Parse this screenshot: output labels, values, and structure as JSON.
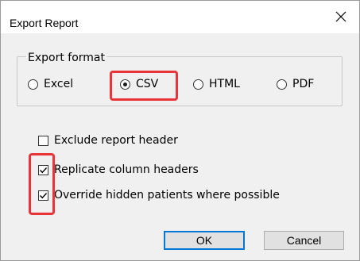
{
  "dialog": {
    "title": "Export Report",
    "close_icon": "close-icon"
  },
  "export_format": {
    "legend": "Export format",
    "options": [
      {
        "label": "Excel",
        "selected": false
      },
      {
        "label": "CSV",
        "selected": true
      },
      {
        "label": "HTML",
        "selected": false
      },
      {
        "label": "PDF",
        "selected": false
      }
    ]
  },
  "options": [
    {
      "label": "Exclude report header",
      "checked": false
    },
    {
      "label": "Replicate column headers",
      "checked": true
    },
    {
      "label": "Override hidden patients where possible",
      "checked": true
    }
  ],
  "buttons": {
    "ok": "OK",
    "cancel": "Cancel"
  },
  "colors": {
    "highlight": "#e8343a",
    "default_button_border": "#0078d7"
  }
}
